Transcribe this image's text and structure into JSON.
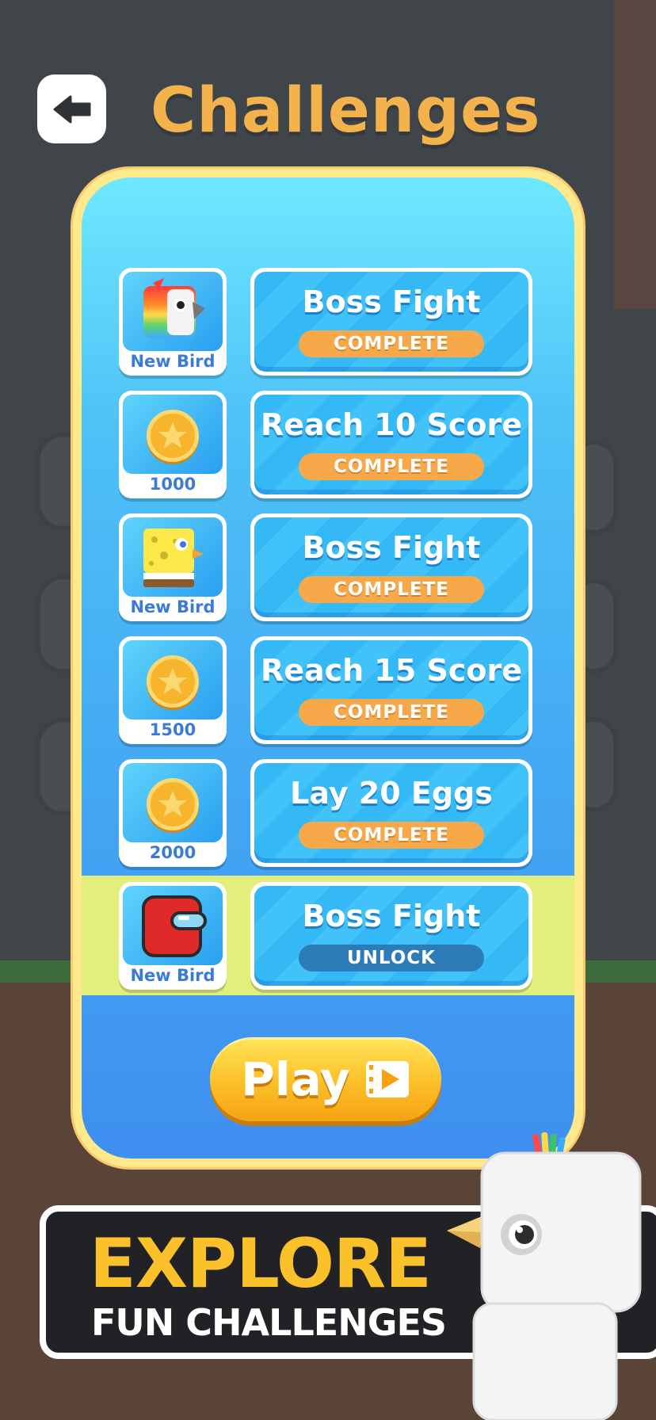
{
  "header": {
    "back_icon": "arrow-left-icon",
    "title": "Challenges"
  },
  "colors": {
    "title": "#f4b24d",
    "panel_border": "#ffe98a",
    "complete_badge": "#f7a94a",
    "unlock_badge": "#2d7cb8",
    "play_button": "#fcc22b",
    "promo_title": "#fbc12a"
  },
  "challenges": [
    {
      "reward_icon": "parrot-bird-icon",
      "reward_label": "New Bird",
      "name": "Boss Fight",
      "status": "COMPLETE"
    },
    {
      "reward_icon": "star-coin-icon",
      "reward_label": "1000",
      "name": "Reach 10 Score",
      "status": "COMPLETE"
    },
    {
      "reward_icon": "sponge-bird-icon",
      "reward_label": "New Bird",
      "name": "Boss Fight",
      "status": "COMPLETE"
    },
    {
      "reward_icon": "star-coin-icon",
      "reward_label": "1500",
      "name": "Reach 15 Score",
      "status": "COMPLETE"
    },
    {
      "reward_icon": "star-coin-icon",
      "reward_label": "2000",
      "name": "Lay 20 Eggs",
      "status": "COMPLETE"
    },
    {
      "reward_icon": "red-crewmate-bird-icon",
      "reward_label": "New Bird",
      "name": "Boss Fight",
      "status": "UNLOCK"
    }
  ],
  "play_button": {
    "label": "Play",
    "icon": "video-play-icon"
  },
  "promo": {
    "title": "EXPLORE",
    "subtitle": "FUN CHALLENGES",
    "mascot_icon": "white-block-bird-icon"
  }
}
